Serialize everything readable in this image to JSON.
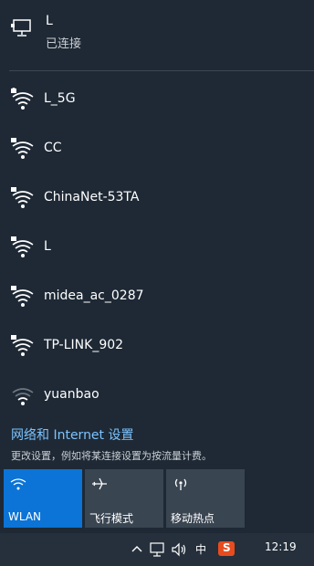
{
  "connected": {
    "ssid": "L",
    "status": "已连接"
  },
  "networks": [
    {
      "ssid": "L_5G",
      "secured": true
    },
    {
      "ssid": "CC",
      "secured": true
    },
    {
      "ssid": "ChinaNet-53TA",
      "secured": true
    },
    {
      "ssid": "L",
      "secured": true
    },
    {
      "ssid": "midea_ac_0287",
      "secured": true
    },
    {
      "ssid": "TP-LINK_902",
      "secured": true
    },
    {
      "ssid": "yuanbao",
      "secured": true
    }
  ],
  "settings": {
    "title": "网络和 Internet 设置",
    "description": "更改设置，例如将某连接设置为按流量计费。"
  },
  "quick_actions": [
    {
      "label": "WLAN",
      "icon": "wifi-icon",
      "active": true
    },
    {
      "label": "飞行模式",
      "icon": "airplane-icon",
      "active": false
    },
    {
      "label": "移动热点",
      "icon": "hotspot-icon",
      "active": false
    }
  ],
  "taskbar": {
    "ime_label": "中",
    "sogou_label": "S",
    "time": "12:19",
    "icons": [
      "chevron-up-icon",
      "network-icon",
      "volume-icon"
    ]
  },
  "colors": {
    "active_tile": "#0b74d6",
    "link": "#7cc3ff"
  }
}
